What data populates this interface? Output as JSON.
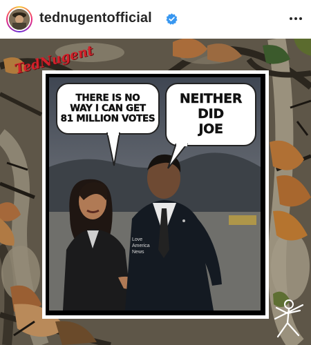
{
  "header": {
    "username": "tednugentofficial",
    "verified": true,
    "avatar_icon": "profile-avatar",
    "more_icon": "more-options-icon"
  },
  "post": {
    "signature_text": "TedNugent",
    "meme": {
      "bubble_left": [
        "THERE IS NO",
        "WAY I CAN GET",
        "81 MILLION VOTES"
      ],
      "bubble_right": [
        "NEITHER",
        "DID",
        "JOE"
      ],
      "watermark": [
        "Love",
        "America",
        "News"
      ]
    }
  },
  "colors": {
    "verified_badge": "#3897f0",
    "signature": "#d3202a",
    "username": "#262626"
  }
}
